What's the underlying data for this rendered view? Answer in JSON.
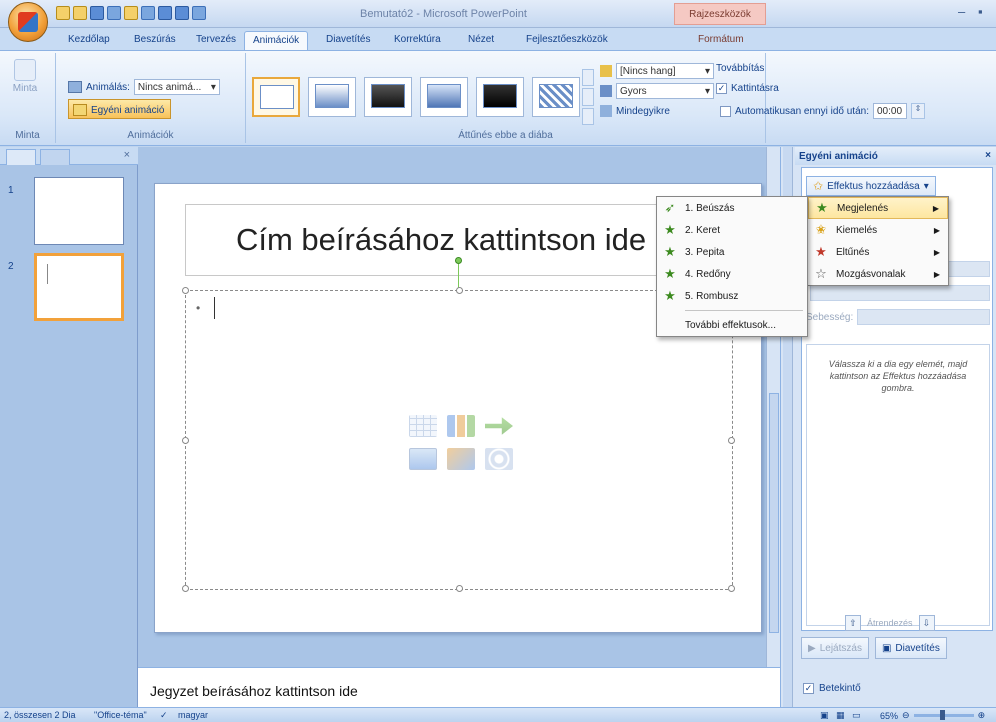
{
  "window": {
    "title": "Bemutató2 - Microsoft PowerPoint",
    "context_tab_title": "Rajzeszközök",
    "min": "–",
    "close": "▪"
  },
  "tabs": [
    "Kezdőlap",
    "Beszúrás",
    "Tervezés",
    "Animációk",
    "Diavetítés",
    "Korrektúra",
    "Nézet",
    "Fejlesztőeszközök",
    "Formátum"
  ],
  "active_tab": "Animációk",
  "ribbon": {
    "preview_label": "Minta",
    "preview_group": "Minta",
    "animation_label": "Animálás:",
    "animation_value": "Nincs animá...",
    "custom_animation": "Egyéni animáció",
    "animations_group": "Animációk",
    "sound_value": "[Nincs hang]",
    "speed_value": "Gyors",
    "apply_all": "Mindegyikre",
    "advance_label": "Továbbítás",
    "on_click": "Kattintásra",
    "auto_after": "Automatikusan ennyi idő után:",
    "auto_time": "00:00",
    "transition_group": "Áttűnés ebbe a diába"
  },
  "slides": {
    "numbers": [
      "1",
      "2"
    ]
  },
  "slide": {
    "title_placeholder": "Cím beírásához kattintson ide",
    "bullet": "•"
  },
  "notes": {
    "placeholder": "Jegyzet beírásához kattintson ide"
  },
  "task_pane": {
    "title": "Egyéni animáció",
    "close": "×",
    "add_effect": "Effektus hozzáadása",
    "speed_label": "Sebesség:",
    "hint": "Válassza ki a dia egy elemét, majd kattintson az Effektus hozzáadása gombra.",
    "reorder": "Átrendezés",
    "play": "Lejátszás",
    "slideshow": "Diavetítés",
    "autopreview": "Betekintő"
  },
  "effect_menu": {
    "items": [
      "Megjelenés",
      "Kiemelés",
      "Eltűnés",
      "Mozgásvonalak"
    ],
    "underline_letters": [
      "M",
      "K",
      "E",
      "v"
    ]
  },
  "entrance_submenu": {
    "items": [
      "1. Beúszás",
      "2. Keret",
      "3. Pepita",
      "4. Redőny",
      "5. Rombusz"
    ],
    "more": "További effektusok..."
  },
  "status": {
    "slide_info": "2, összesen 2 Dia",
    "theme": "\"Office-téma\"",
    "language": "magyar",
    "zoom": "65%"
  },
  "colors": {
    "ribbon_bg": "#d9e7f8",
    "highlight": "#fde6a0",
    "context_tab": "#f5c9c3"
  }
}
